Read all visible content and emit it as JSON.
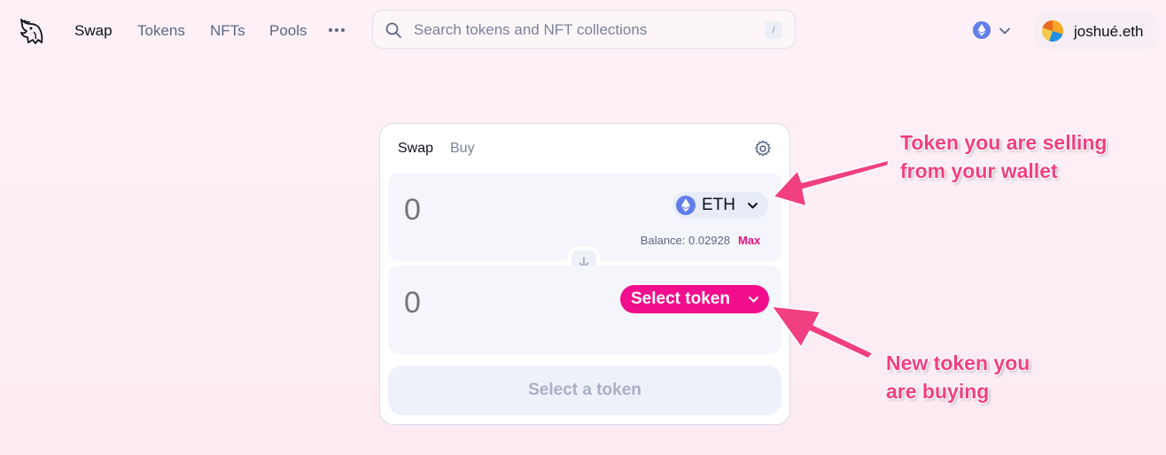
{
  "nav": {
    "links": [
      "Swap",
      "Tokens",
      "NFTs",
      "Pools"
    ],
    "more_icon": "ellipsis-icon",
    "logo_icon": "unicorn-logo-icon"
  },
  "search": {
    "placeholder": "Search tokens and NFT collections",
    "shortcut": "/",
    "icon": "search-icon"
  },
  "network": {
    "icon": "ethereum-icon",
    "chevron": "chevron-down-icon"
  },
  "account": {
    "name": "joshué.eth"
  },
  "swap_card": {
    "tabs": [
      "Swap",
      "Buy"
    ],
    "settings_icon": "gear-icon",
    "sell": {
      "amount": "0",
      "token_symbol": "ETH",
      "balance_text": "Balance: 0.02928",
      "max_label": "Max"
    },
    "switch_icon": "arrow-down-icon",
    "buy": {
      "amount": "0",
      "select_label": "Select token"
    },
    "action_label": "Select a token"
  },
  "annotations": {
    "selling": [
      "Token you are selling",
      "from your wallet"
    ],
    "buying": [
      "New token you",
      "are buying"
    ],
    "color": "#f13f81"
  },
  "colors": {
    "accent": "#f10d8b",
    "eth_blue": "#627eea"
  }
}
